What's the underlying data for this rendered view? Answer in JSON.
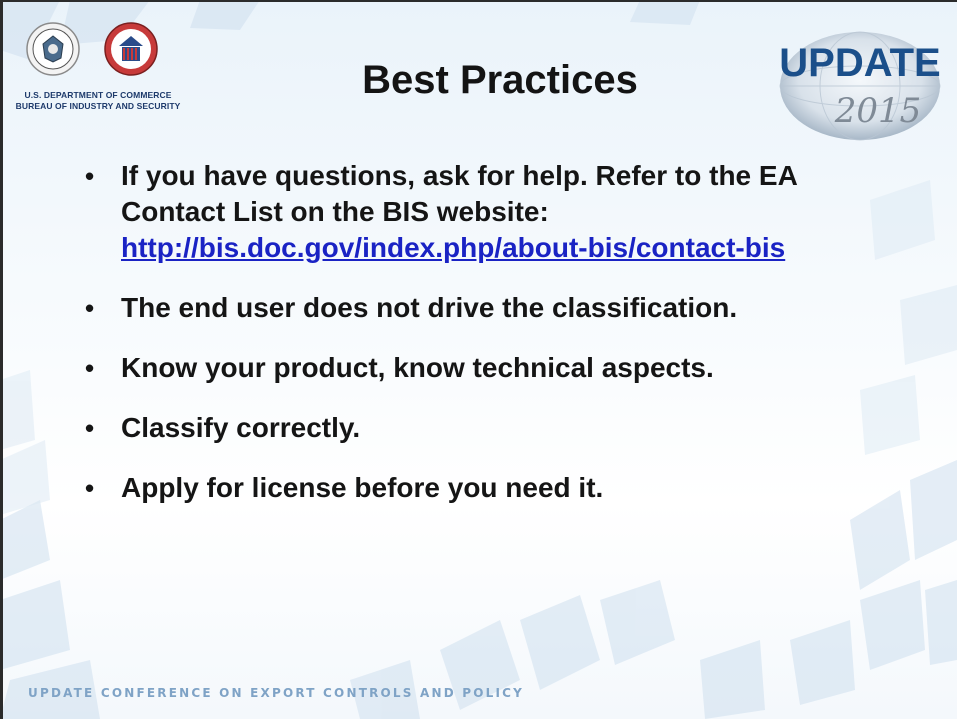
{
  "header": {
    "department_line1": "U.S. DEPARTMENT OF COMMERCE",
    "department_line2": "BUREAU OF INDUSTRY AND SECURITY",
    "update_word": "UPDATE",
    "update_year": "2015"
  },
  "title": "Best Practices",
  "bullets": {
    "b1_text": "If you have questions, ask for help. Refer to the EA Contact List on the BIS website: ",
    "b1_link": "http://bis.doc.gov/index.php/about-bis/contact-bis",
    "b2": "The end user does not drive the classification.",
    "b3": "Know your product, know technical aspects.",
    "b4": "Classify correctly.",
    "b5": "Apply for license before you need it."
  },
  "footer": "UPDATE CONFERENCE ON EXPORT CONTROLS  AND POLICY",
  "colors": {
    "accent": "#1a23c4",
    "navy": "#1d3a6b",
    "footer": "#7fa3c6"
  }
}
